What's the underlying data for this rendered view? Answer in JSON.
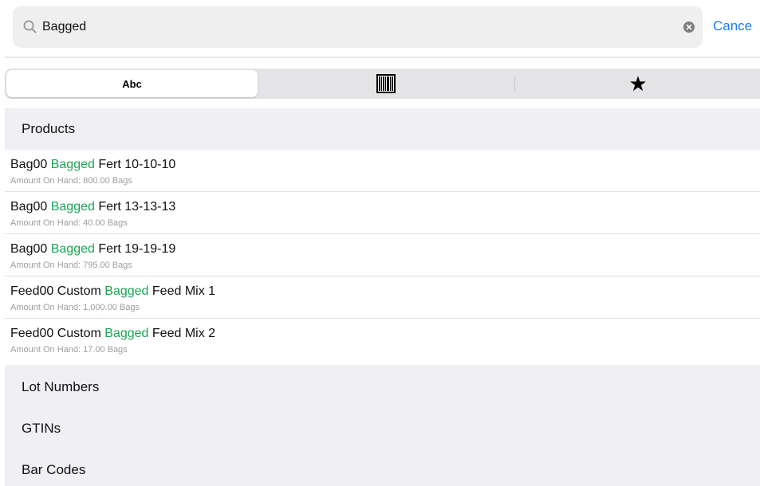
{
  "search": {
    "value": "Bagged",
    "cancel_label": "Cance"
  },
  "segments": {
    "abc_label": "Abc",
    "barcode_icon": "barcode-icon",
    "star_icon": "star-icon",
    "star_glyph": "★",
    "selected": "Abc"
  },
  "sections": {
    "products": "Products",
    "lot_numbers": "Lot Numbers",
    "gtins": "GTINs",
    "bar_codes": "Bar Codes"
  },
  "products": [
    {
      "prefix": "Bag00 ",
      "highlight": "Bagged",
      "suffix": " Fert 10-10-10",
      "subtitle": "Amount On Hand: 800.00 Bags"
    },
    {
      "prefix": "Bag00 ",
      "highlight": "Bagged",
      "suffix": " Fert 13-13-13",
      "subtitle": "Amount On Hand: 40.00 Bags"
    },
    {
      "prefix": "Bag00 ",
      "highlight": "Bagged",
      "suffix": " Fert 19-19-19",
      "subtitle": "Amount On Hand: 795.00 Bags"
    },
    {
      "prefix": "Feed00 Custom ",
      "highlight": "Bagged",
      "suffix": " Feed Mix 1",
      "subtitle": "Amount On Hand: 1,000.00 Bags"
    },
    {
      "prefix": "Feed00 Custom ",
      "highlight": "Bagged",
      "suffix": " Feed Mix 2",
      "subtitle": "Amount On Hand: 17.00 Bags"
    }
  ],
  "colors": {
    "accent": "#1a7bf0",
    "highlight": "#1aa553",
    "section_bg": "#efeff4"
  }
}
